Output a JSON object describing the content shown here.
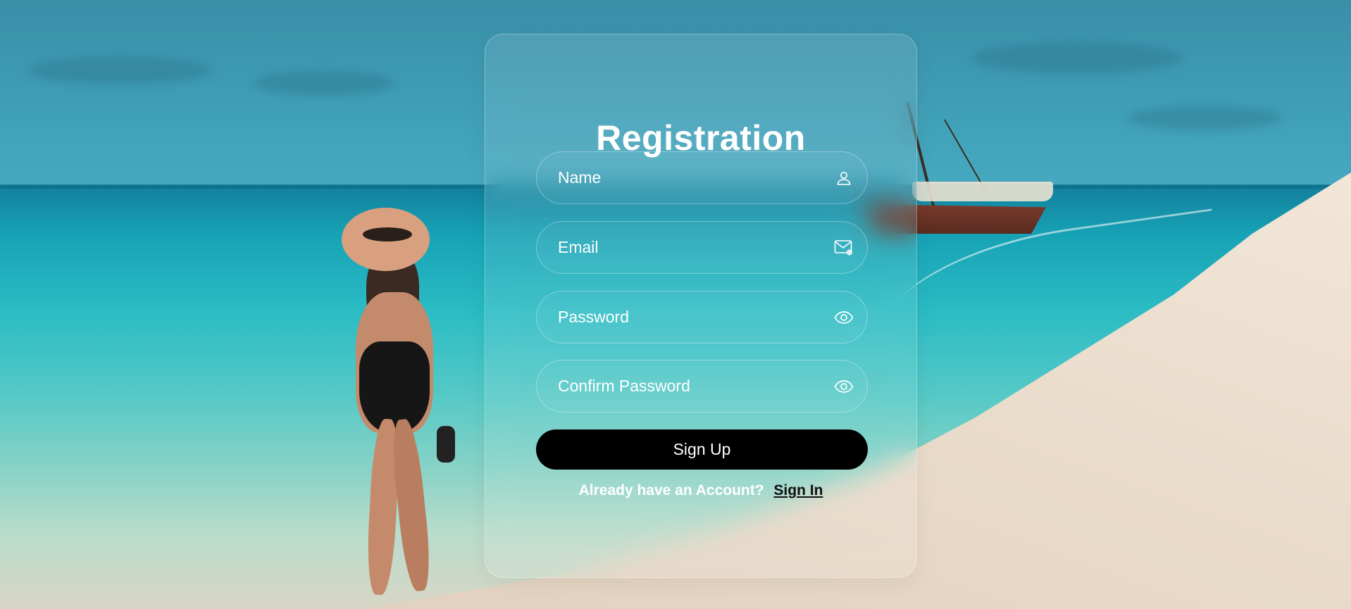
{
  "form": {
    "title": "Registration",
    "fields": [
      {
        "placeholder": "Name",
        "icon": "user-icon"
      },
      {
        "placeholder": "Email",
        "icon": "mail-icon"
      },
      {
        "placeholder": "Password",
        "icon": "eye-icon"
      },
      {
        "placeholder": "Confirm Password",
        "icon": "eye-icon"
      }
    ],
    "submit_label": "Sign Up",
    "footer_prompt": "Already have an Account?",
    "footer_link": "Sign In"
  },
  "colors": {
    "button_bg": "#000000",
    "text_primary": "#ffffff",
    "link": "#111111"
  }
}
